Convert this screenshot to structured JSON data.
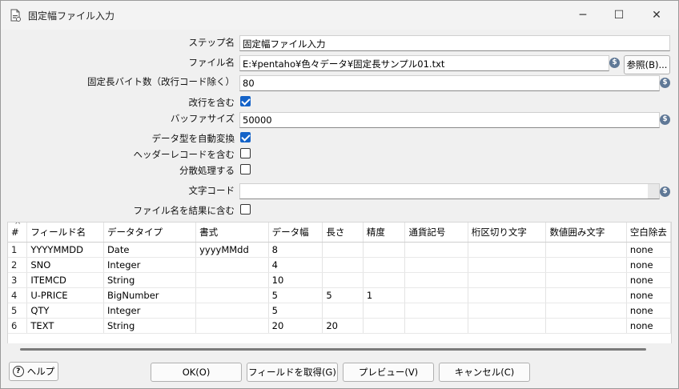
{
  "window": {
    "title": "固定幅ファイル入力",
    "minimize_glyph": "─",
    "maximize_glyph": "☐",
    "close_glyph": "✕"
  },
  "form": {
    "step_name_label": "ステップ名",
    "step_name_value": "固定幅ファイル入力",
    "filename_label": "ファイル名",
    "filename_value": "E:¥pentaho¥色々データ¥固定長サンプル01.txt",
    "browse_button": "参照(B)...",
    "line_width_label": "固定長バイト数（改行コード除く）",
    "line_width_value": "80",
    "line_feed_label": "改行を含む",
    "line_feed_checked": true,
    "buffer_size_label": "バッファサイズ",
    "buffer_size_value": "50000",
    "lazy_conversion_label": "データ型を自動変換",
    "lazy_conversion_checked": true,
    "header_row_label": "ヘッダーレコードを含む",
    "header_row_checked": false,
    "parallel_label": "分散処理する",
    "parallel_checked": false,
    "encoding_label": "文字コード",
    "encoding_value": "",
    "add_filename_label": "ファイル名を結果に含む",
    "add_filename_checked": false,
    "variable_icon_glyph": "$"
  },
  "table": {
    "sort_indicator": "^",
    "columns": [
      "#",
      "フィールド名",
      "データタイプ",
      "書式",
      "データ幅",
      "長さ",
      "精度",
      "通貨記号",
      "桁区切り文字",
      "数値囲み文字",
      "空白除去"
    ],
    "rows": [
      [
        "1",
        "YYYYMMDD",
        "Date",
        "yyyyMMdd",
        "8",
        "",
        "",
        "",
        "",
        "",
        "none"
      ],
      [
        "2",
        "SNO",
        "Integer",
        "",
        "4",
        "",
        "",
        "",
        "",
        "",
        "none"
      ],
      [
        "3",
        "ITEMCD",
        "String",
        "",
        "10",
        "",
        "",
        "",
        "",
        "",
        "none"
      ],
      [
        "4",
        "U-PRICE",
        "BigNumber",
        "",
        "5",
        "5",
        "1",
        "",
        "",
        "",
        "none"
      ],
      [
        "5",
        "QTY",
        "Integer",
        "",
        "5",
        "",
        "",
        "",
        "",
        "",
        "none"
      ],
      [
        "6",
        "TEXT",
        "String",
        "",
        "20",
        "20",
        "",
        "",
        "",
        "",
        "none"
      ]
    ]
  },
  "buttons": {
    "help": "ヘルプ",
    "help_icon_glyph": "?",
    "ok": "OK(O)",
    "get_fields": "フィールドを取得(G)",
    "preview": "プレビュー(V)",
    "cancel": "キャンセル(C)"
  }
}
